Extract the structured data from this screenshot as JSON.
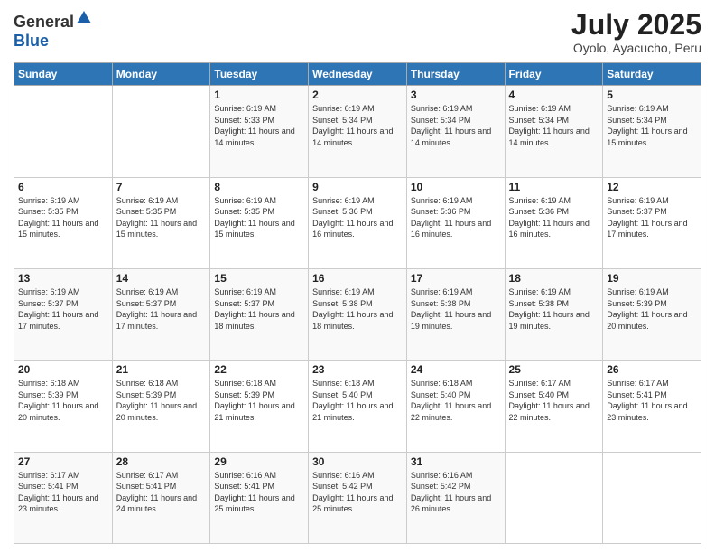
{
  "logo": {
    "text_general": "General",
    "text_blue": "Blue"
  },
  "header": {
    "month_year": "July 2025",
    "location": "Oyolo, Ayacucho, Peru"
  },
  "weekdays": [
    "Sunday",
    "Monday",
    "Tuesday",
    "Wednesday",
    "Thursday",
    "Friday",
    "Saturday"
  ],
  "weeks": [
    [
      {
        "day": "",
        "info": ""
      },
      {
        "day": "",
        "info": ""
      },
      {
        "day": "1",
        "info": "Sunrise: 6:19 AM\nSunset: 5:33 PM\nDaylight: 11 hours and 14 minutes."
      },
      {
        "day": "2",
        "info": "Sunrise: 6:19 AM\nSunset: 5:34 PM\nDaylight: 11 hours and 14 minutes."
      },
      {
        "day": "3",
        "info": "Sunrise: 6:19 AM\nSunset: 5:34 PM\nDaylight: 11 hours and 14 minutes."
      },
      {
        "day": "4",
        "info": "Sunrise: 6:19 AM\nSunset: 5:34 PM\nDaylight: 11 hours and 14 minutes."
      },
      {
        "day": "5",
        "info": "Sunrise: 6:19 AM\nSunset: 5:34 PM\nDaylight: 11 hours and 15 minutes."
      }
    ],
    [
      {
        "day": "6",
        "info": "Sunrise: 6:19 AM\nSunset: 5:35 PM\nDaylight: 11 hours and 15 minutes."
      },
      {
        "day": "7",
        "info": "Sunrise: 6:19 AM\nSunset: 5:35 PM\nDaylight: 11 hours and 15 minutes."
      },
      {
        "day": "8",
        "info": "Sunrise: 6:19 AM\nSunset: 5:35 PM\nDaylight: 11 hours and 15 minutes."
      },
      {
        "day": "9",
        "info": "Sunrise: 6:19 AM\nSunset: 5:36 PM\nDaylight: 11 hours and 16 minutes."
      },
      {
        "day": "10",
        "info": "Sunrise: 6:19 AM\nSunset: 5:36 PM\nDaylight: 11 hours and 16 minutes."
      },
      {
        "day": "11",
        "info": "Sunrise: 6:19 AM\nSunset: 5:36 PM\nDaylight: 11 hours and 16 minutes."
      },
      {
        "day": "12",
        "info": "Sunrise: 6:19 AM\nSunset: 5:37 PM\nDaylight: 11 hours and 17 minutes."
      }
    ],
    [
      {
        "day": "13",
        "info": "Sunrise: 6:19 AM\nSunset: 5:37 PM\nDaylight: 11 hours and 17 minutes."
      },
      {
        "day": "14",
        "info": "Sunrise: 6:19 AM\nSunset: 5:37 PM\nDaylight: 11 hours and 17 minutes."
      },
      {
        "day": "15",
        "info": "Sunrise: 6:19 AM\nSunset: 5:37 PM\nDaylight: 11 hours and 18 minutes."
      },
      {
        "day": "16",
        "info": "Sunrise: 6:19 AM\nSunset: 5:38 PM\nDaylight: 11 hours and 18 minutes."
      },
      {
        "day": "17",
        "info": "Sunrise: 6:19 AM\nSunset: 5:38 PM\nDaylight: 11 hours and 19 minutes."
      },
      {
        "day": "18",
        "info": "Sunrise: 6:19 AM\nSunset: 5:38 PM\nDaylight: 11 hours and 19 minutes."
      },
      {
        "day": "19",
        "info": "Sunrise: 6:19 AM\nSunset: 5:39 PM\nDaylight: 11 hours and 20 minutes."
      }
    ],
    [
      {
        "day": "20",
        "info": "Sunrise: 6:18 AM\nSunset: 5:39 PM\nDaylight: 11 hours and 20 minutes."
      },
      {
        "day": "21",
        "info": "Sunrise: 6:18 AM\nSunset: 5:39 PM\nDaylight: 11 hours and 20 minutes."
      },
      {
        "day": "22",
        "info": "Sunrise: 6:18 AM\nSunset: 5:39 PM\nDaylight: 11 hours and 21 minutes."
      },
      {
        "day": "23",
        "info": "Sunrise: 6:18 AM\nSunset: 5:40 PM\nDaylight: 11 hours and 21 minutes."
      },
      {
        "day": "24",
        "info": "Sunrise: 6:18 AM\nSunset: 5:40 PM\nDaylight: 11 hours and 22 minutes."
      },
      {
        "day": "25",
        "info": "Sunrise: 6:17 AM\nSunset: 5:40 PM\nDaylight: 11 hours and 22 minutes."
      },
      {
        "day": "26",
        "info": "Sunrise: 6:17 AM\nSunset: 5:41 PM\nDaylight: 11 hours and 23 minutes."
      }
    ],
    [
      {
        "day": "27",
        "info": "Sunrise: 6:17 AM\nSunset: 5:41 PM\nDaylight: 11 hours and 23 minutes."
      },
      {
        "day": "28",
        "info": "Sunrise: 6:17 AM\nSunset: 5:41 PM\nDaylight: 11 hours and 24 minutes."
      },
      {
        "day": "29",
        "info": "Sunrise: 6:16 AM\nSunset: 5:41 PM\nDaylight: 11 hours and 25 minutes."
      },
      {
        "day": "30",
        "info": "Sunrise: 6:16 AM\nSunset: 5:42 PM\nDaylight: 11 hours and 25 minutes."
      },
      {
        "day": "31",
        "info": "Sunrise: 6:16 AM\nSunset: 5:42 PM\nDaylight: 11 hours and 26 minutes."
      },
      {
        "day": "",
        "info": ""
      },
      {
        "day": "",
        "info": ""
      }
    ]
  ]
}
